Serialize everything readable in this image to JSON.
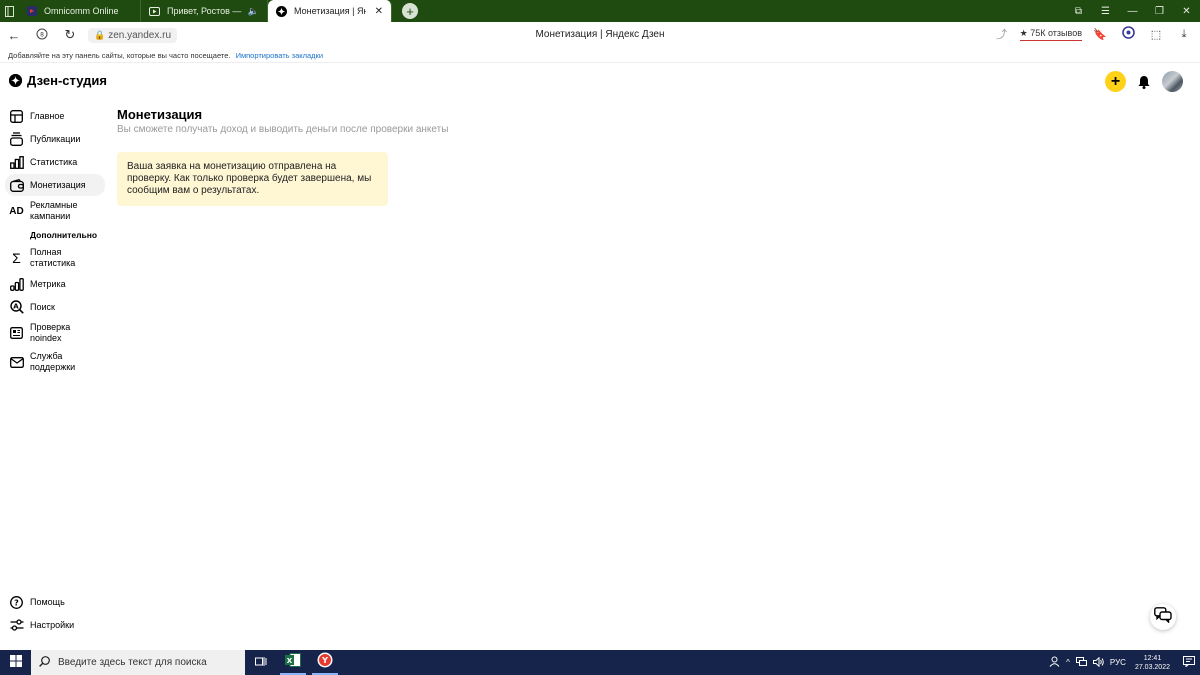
{
  "browser": {
    "tabs": [
      {
        "title": "Omnicomm Online",
        "icon": "omnicomm-icon",
        "active": false
      },
      {
        "title": "Привет, Ростов — В",
        "icon": "youtube-icon",
        "active": false
      },
      {
        "title": "Монетизация | Яндекс",
        "icon": "zen-icon",
        "active": true
      }
    ],
    "url": "zen.yandex.ru",
    "page_title": "Монетизация | Яндекс Дзен",
    "reviews": "★ 75К отзывов",
    "bookmarks_hint": "Добавляйте на эту панель сайты, которые вы часто посещаете.",
    "bookmarks_link": "Импортировать закладки"
  },
  "studio": {
    "logo": "Дзен-студия"
  },
  "sidebar": {
    "items": [
      {
        "label": "Главное",
        "icon": "home-icon"
      },
      {
        "label": "Публикации",
        "icon": "publications-icon"
      },
      {
        "label": "Статистика",
        "icon": "stats-icon"
      },
      {
        "label": "Монетизация",
        "icon": "wallet-icon",
        "active": true
      },
      {
        "label": "Рекламные кампании",
        "icon": "ad-icon"
      }
    ],
    "section": "Дополнительно",
    "extra": [
      {
        "label": "Полная статистика",
        "icon": "sigma-icon"
      },
      {
        "label": "Метрика",
        "icon": "metrika-icon"
      },
      {
        "label": "Поиск",
        "icon": "search-icon"
      },
      {
        "label": "Проверка noindex",
        "icon": "noindex-icon"
      },
      {
        "label": "Служба поддержки",
        "icon": "mail-icon"
      }
    ],
    "bottom": [
      {
        "label": "Помощь",
        "icon": "help-icon"
      },
      {
        "label": "Настройки",
        "icon": "settings-icon"
      }
    ]
  },
  "main": {
    "title": "Монетизация",
    "subtitle": "Вы сможете получать доход и выводить деньги после проверки анкеты",
    "notice": "Ваша заявка на монетизацию отправлена на проверку. Как только проверка будет завершена, мы сообщим вам о результатах."
  },
  "taskbar": {
    "search_placeholder": "Введите здесь текст для поиска",
    "lang": "РУС",
    "time": "12:41",
    "date": "27.03.2022"
  },
  "colors": {
    "tabbar": "#1f4a10",
    "accent_yellow": "#ffd21a",
    "notice_bg": "#fff6d4",
    "taskbar": "#16234a"
  }
}
